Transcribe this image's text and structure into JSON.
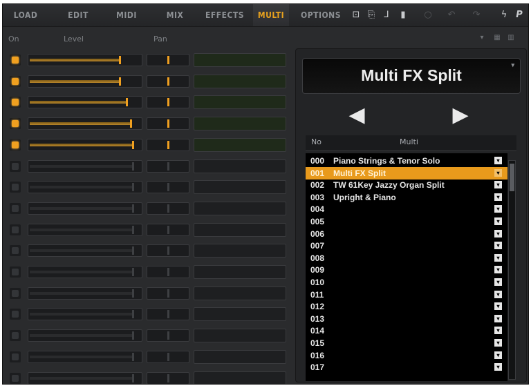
{
  "tabs": [
    {
      "label": "LOAD",
      "active": false
    },
    {
      "label": "EDIT",
      "active": false
    },
    {
      "label": "MIDI",
      "active": false
    },
    {
      "label": "MIX",
      "active": false
    },
    {
      "label": "EFFECTS",
      "active": false
    },
    {
      "label": "MULTI",
      "active": true
    },
    {
      "label": "OPTIONS",
      "active": false
    }
  ],
  "toolbar_icons": [
    "routing-icon",
    "copy-icon",
    "connector-icon",
    "lock-icon",
    "power-icon",
    "undo-icon",
    "redo-icon",
    "settings-icon",
    "p-icon"
  ],
  "toolbar_glyphs": {
    "routing": "⊡",
    "copy": "⎘",
    "connector": "⅃",
    "lock": "▮",
    "power": "○",
    "undo": "↶",
    "redo": "↷",
    "settings": "ϟ",
    "p": "P"
  },
  "channel_header": {
    "on": "On",
    "level": "Level",
    "pan": "Pan"
  },
  "channels": [
    {
      "on": true,
      "level": 0.82,
      "pan": 0.5
    },
    {
      "on": true,
      "level": 0.82,
      "pan": 0.5
    },
    {
      "on": true,
      "level": 0.88,
      "pan": 0.5
    },
    {
      "on": true,
      "level": 0.92,
      "pan": 0.5
    },
    {
      "on": true,
      "level": 0.94,
      "pan": 0.5
    },
    {
      "on": false,
      "level": 0.94,
      "pan": 0.5
    },
    {
      "on": false,
      "level": 0.94,
      "pan": 0.5
    },
    {
      "on": false,
      "level": 0.94,
      "pan": 0.5
    },
    {
      "on": false,
      "level": 0.94,
      "pan": 0.5
    },
    {
      "on": false,
      "level": 0.94,
      "pan": 0.5
    },
    {
      "on": false,
      "level": 0.94,
      "pan": 0.5
    },
    {
      "on": false,
      "level": 0.94,
      "pan": 0.5
    },
    {
      "on": false,
      "level": 0.94,
      "pan": 0.5
    },
    {
      "on": false,
      "level": 0.94,
      "pan": 0.5
    },
    {
      "on": false,
      "level": 0.94,
      "pan": 0.5
    },
    {
      "on": false,
      "level": 0.94,
      "pan": 0.5
    }
  ],
  "multi": {
    "current_name": "Multi FX Split",
    "prev_arrow": "◀",
    "next_arrow": "▶",
    "list_header": {
      "no": "No",
      "multi": "Multi"
    },
    "items": [
      {
        "no": "000",
        "name": "Piano Strings & Tenor Solo"
      },
      {
        "no": "001",
        "name": "Multi FX Split",
        "selected": true
      },
      {
        "no": "002",
        "name": "TW 61Key Jazzy Organ Split"
      },
      {
        "no": "003",
        "name": "Upright & Piano"
      },
      {
        "no": "004",
        "name": ""
      },
      {
        "no": "005",
        "name": ""
      },
      {
        "no": "006",
        "name": ""
      },
      {
        "no": "007",
        "name": ""
      },
      {
        "no": "008",
        "name": ""
      },
      {
        "no": "009",
        "name": ""
      },
      {
        "no": "010",
        "name": ""
      },
      {
        "no": "011",
        "name": ""
      },
      {
        "no": "012",
        "name": ""
      },
      {
        "no": "013",
        "name": ""
      },
      {
        "no": "014",
        "name": ""
      },
      {
        "no": "015",
        "name": ""
      },
      {
        "no": "016",
        "name": ""
      },
      {
        "no": "017",
        "name": ""
      }
    ]
  },
  "colors": {
    "accent": "#e89a1c",
    "panel": "#2a2b2d",
    "text": "#e6e6e6"
  }
}
